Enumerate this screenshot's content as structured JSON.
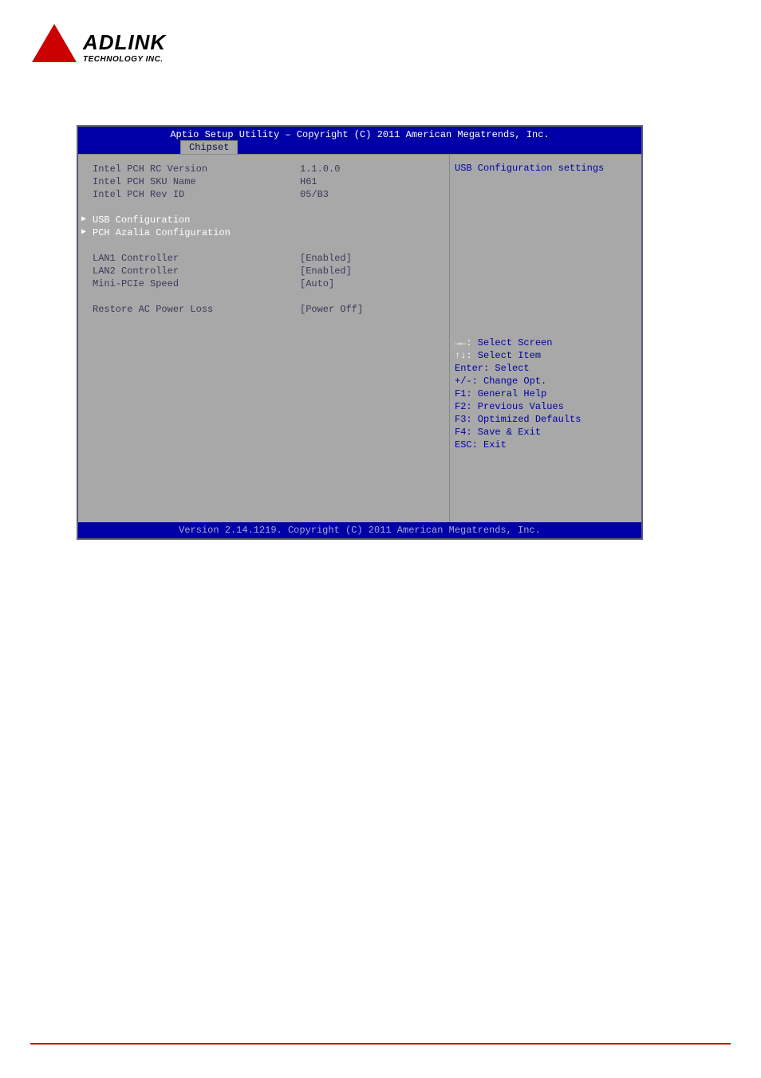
{
  "logo": {
    "brand": "ADLINK",
    "tagline": "TECHNOLOGY INC."
  },
  "bios": {
    "header_title": "Aptio Setup Utility – Copyright (C) 2011 American Megatrends, Inc.",
    "tab": "Chipset",
    "info": {
      "rc_version_label": "Intel PCH RC Version",
      "rc_version_value": "1.1.0.0",
      "sku_name_label": "Intel PCH SKU Name",
      "sku_name_value": "H61",
      "rev_id_label": "Intel PCH Rev ID",
      "rev_id_value": "05/B3"
    },
    "submenus": {
      "usb": "USB Configuration",
      "azalia": "PCH Azalia Configuration"
    },
    "options": {
      "lan1_label": "LAN1 Controller",
      "lan1_value": "[Enabled]",
      "lan2_label": "LAN2 Controller",
      "lan2_value": "[Enabled]",
      "minipcie_label": "Mini-PCIe Speed",
      "minipcie_value": "[Auto]",
      "restore_label": "Restore AC Power Loss",
      "restore_value": "[Power Off]"
    },
    "right_help": "USB Configuration settings",
    "nav": {
      "l1_k": "→←:",
      "l1_t": " Select Screen",
      "l2_k": "↑↓:",
      "l2_t": " Select Item",
      "l3": "Enter: Select",
      "l4": "+/-: Change Opt.",
      "l5": "F1: General Help",
      "l6": "F2: Previous Values",
      "l7": "F3: Optimized Defaults",
      "l8": "F4: Save & Exit",
      "l9": "ESC: Exit"
    },
    "footer": "Version 2.14.1219. Copyright (C) 2011 American Megatrends, Inc."
  }
}
